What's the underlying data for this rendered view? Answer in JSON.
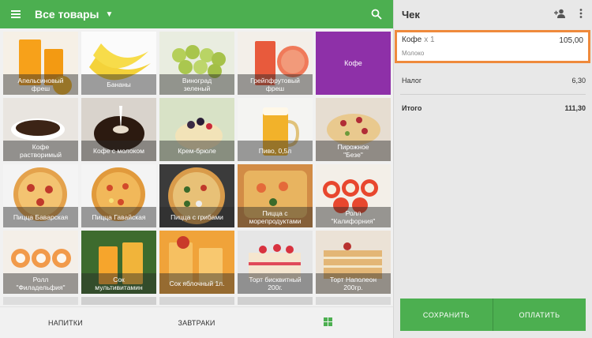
{
  "header": {
    "category": "Все товары",
    "menu_icon": "menu-icon",
    "search_icon": "search-icon"
  },
  "products": [
    {
      "label": "Апельсиновый\nфреш",
      "icon": "orange-juice"
    },
    {
      "label": "Бананы",
      "icon": "banana"
    },
    {
      "label": "Виноград\nзеленый",
      "icon": "grapes"
    },
    {
      "label": "Грейпфрутовый\nфреш",
      "icon": "grapefruit-juice"
    },
    {
      "label": "Кофе",
      "icon": "coffee-tile",
      "color": "#8e30a8"
    },
    {
      "label": "Кофе\nрастворимый",
      "icon": "coffee-cup"
    },
    {
      "label": "Кофе с молоком",
      "icon": "coffee-milk"
    },
    {
      "label": "Крем-брюле",
      "icon": "creme-brulee"
    },
    {
      "label": "Пиво, 0,5л",
      "icon": "beer"
    },
    {
      "label": "Пирожное\n\"Безе\"",
      "icon": "meringue"
    },
    {
      "label": "Пицца Баварская",
      "icon": "pizza"
    },
    {
      "label": "Пицца Гавайская",
      "icon": "pizza"
    },
    {
      "label": "Пицца с грибами",
      "icon": "pizza"
    },
    {
      "label": "Пицца с\nморепродуктами",
      "icon": "pizza"
    },
    {
      "label": "Ролл\n\"Калифорния\"",
      "icon": "sushi"
    },
    {
      "label": "Ролл\n\"Филадельфия\"",
      "icon": "sushi"
    },
    {
      "label": "Сок\nмультивитамин",
      "icon": "juice"
    },
    {
      "label": "Сок яблочный 1л.",
      "icon": "apple-juice"
    },
    {
      "label": "Торт бисквитный\n200г.",
      "icon": "cake"
    },
    {
      "label": "Торт Наполеон\n200гр.",
      "icon": "cake"
    }
  ],
  "bottom_tabs": [
    "НАПИТКИ",
    "ЗАВТРАКИ"
  ],
  "receipt": {
    "title": "Чек",
    "add_customer_icon": "add-person-icon",
    "more_icon": "more-vertical-icon",
    "item": {
      "name": "Кофе",
      "qty": "x 1",
      "price": "105,00",
      "modifier": "Молоко"
    },
    "tax_label": "Налог",
    "tax_value": "6,30",
    "total_label": "Итого",
    "total_value": "111,30",
    "save_label": "СОХРАНИТЬ",
    "pay_label": "ОПЛАТИТЬ"
  },
  "colors": {
    "accent": "#4caf50",
    "highlight": "#ef8a3c",
    "coffee_tile": "#8e30a8"
  }
}
